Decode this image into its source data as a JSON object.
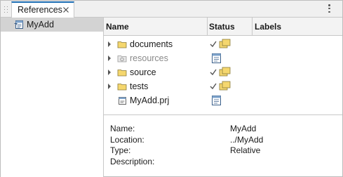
{
  "tab": {
    "label": "References"
  },
  "left": {
    "project_name": "MyAdd"
  },
  "table": {
    "headers": {
      "name": "Name",
      "status": "Status",
      "labels": "Labels"
    },
    "rows": [
      {
        "name": "documents",
        "type": "folder",
        "expandable": true,
        "dim": false,
        "status": "check-folder"
      },
      {
        "name": "resources",
        "type": "folder-dim",
        "expandable": true,
        "dim": true,
        "status": "project-ref"
      },
      {
        "name": "source",
        "type": "folder",
        "expandable": true,
        "dim": false,
        "status": "check-folder"
      },
      {
        "name": "tests",
        "type": "folder",
        "expandable": true,
        "dim": false,
        "status": "check-folder"
      },
      {
        "name": "MyAdd.prj",
        "type": "prj-file",
        "expandable": false,
        "dim": false,
        "status": "project-ref"
      }
    ]
  },
  "details": {
    "name_key": "Name:",
    "name_val": "MyAdd",
    "location_key": "Location:",
    "location_val": "../MyAdd",
    "type_key": "Type:",
    "type_val": "Relative",
    "description_key": "Description:",
    "description_val": ""
  },
  "colors": {
    "accent": "#1f6fb5",
    "folder": "#f5d76e",
    "selected_bg": "#d3d3d3"
  }
}
